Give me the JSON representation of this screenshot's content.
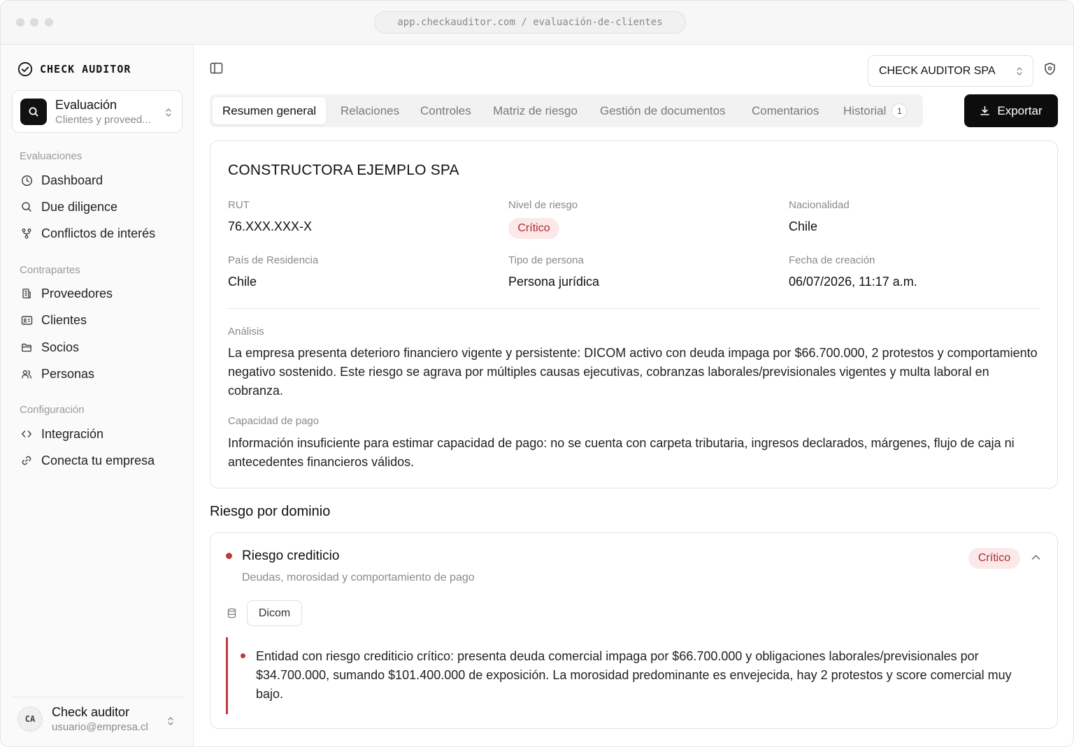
{
  "browser": {
    "url": "app.checkauditor.com / evaluación-de-clientes"
  },
  "sidebar": {
    "brand": "CHECK AUDITOR",
    "switcher": {
      "title": "Evaluación",
      "subtitle": "Clientes y proveed..."
    },
    "sections": [
      {
        "label": "Evaluaciones",
        "items": [
          {
            "label": "Dashboard",
            "icon": "clock-icon"
          },
          {
            "label": "Due diligence",
            "icon": "search-icon"
          },
          {
            "label": "Conflictos de interés",
            "icon": "git-fork-icon"
          }
        ]
      },
      {
        "label": "Contrapartes",
        "items": [
          {
            "label": "Proveedores",
            "icon": "building-icon"
          },
          {
            "label": "Clientes",
            "icon": "id-card-icon"
          },
          {
            "label": "Socios",
            "icon": "folder-icon"
          },
          {
            "label": "Personas",
            "icon": "users-icon"
          }
        ]
      },
      {
        "label": "Configuración",
        "items": [
          {
            "label": "Integración",
            "icon": "code-icon"
          },
          {
            "label": "Conecta tu empresa",
            "icon": "link-icon"
          }
        ]
      }
    ],
    "user": {
      "initials": "CA",
      "name": "Check auditor",
      "email": "usuario@empresa.cl"
    }
  },
  "header": {
    "company": "CHECK AUDITOR SPA",
    "export_label": "Exportar"
  },
  "tabs": [
    {
      "label": "Resumen general",
      "active": true
    },
    {
      "label": "Relaciones"
    },
    {
      "label": "Controles"
    },
    {
      "label": "Matriz de riesgo"
    },
    {
      "label": "Gestión de documentos"
    },
    {
      "label": "Comentarios"
    },
    {
      "label": "Historial",
      "badge": "1"
    }
  ],
  "summary": {
    "title": "CONSTRUCTORA EJEMPLO SPA",
    "fields": {
      "rut": {
        "label": "RUT",
        "value": "76.XXX.XXX-X"
      },
      "risk": {
        "label": "Nivel de riesgo",
        "value": "Crítico"
      },
      "nationality": {
        "label": "Nacionalidad",
        "value": "Chile"
      },
      "residence": {
        "label": "País de Residencia",
        "value": "Chile"
      },
      "person_type": {
        "label": "Tipo de persona",
        "value": "Persona jurídica"
      },
      "created": {
        "label": "Fecha de creación",
        "value": "06/07/2026, 11:17 a.m."
      }
    },
    "analysis": {
      "label": "Análisis",
      "text": "La empresa presenta deterioro financiero vigente y persistente: DICOM activo con deuda impaga por $66.700.000, 2 protestos y comportamiento negativo sostenido. Este riesgo se agrava por múltiples causas ejecutivas, cobranzas laborales/previsionales vigentes y multa laboral en cobranza."
    },
    "capacity": {
      "label": "Capacidad de pago",
      "text": "Información insuficiente para estimar capacidad de pago: no se cuenta con carpeta tributaria, ingresos declarados, márgenes, flujo de caja ni antecedentes financieros válidos."
    }
  },
  "domains": {
    "title": "Riesgo por dominio",
    "items": [
      {
        "name": "Riesgo crediticio",
        "description": "Deudas, morosidad y comportamiento de pago",
        "level": "Crítico",
        "source": "Dicom",
        "finding": "Entidad con riesgo crediticio crítico: presenta deuda comercial impaga por $66.700.000 y obligaciones laborales/previsionales por $34.700.000, sumando $101.400.000 de exposición. La morosidad predominante es envejecida, hay 2 protestos y score comercial muy bajo."
      }
    ]
  },
  "colors": {
    "critical_text": "#b3262d",
    "critical_bg": "#fbe9e9",
    "accent_dark": "#0d0d0d"
  }
}
